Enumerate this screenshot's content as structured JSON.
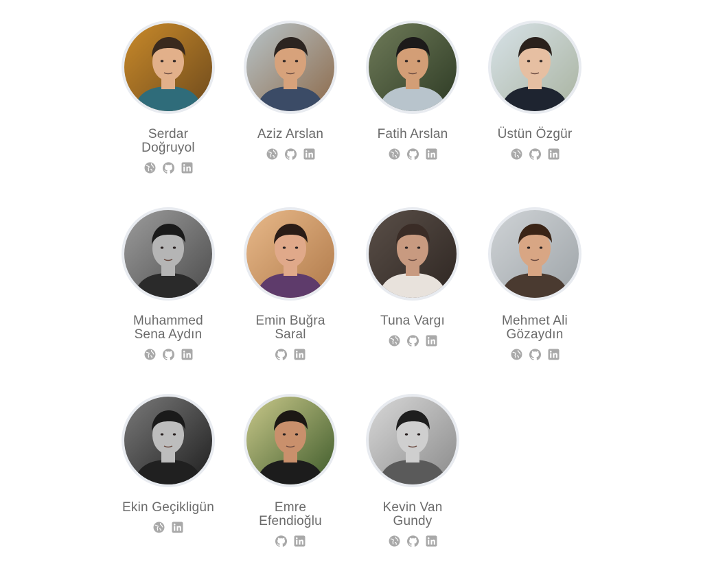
{
  "colors": {
    "icon": "#a9a9a9",
    "avatar_ring": "#e8ebf0",
    "name_text": "#6b6b6b"
  },
  "members": [
    {
      "first": "Serdar",
      "last": "Doğruyol",
      "links": [
        "globe-icon",
        "github-icon",
        "linkedin-icon"
      ],
      "bg": [
        "#c98a2a",
        "#6e4a1c"
      ],
      "skin": "#e2b08a",
      "hair": "#3a2a1e",
      "shirt": "#2f6c7a",
      "gray": false
    },
    {
      "first": "Aziz Arslan",
      "last": "",
      "links": [
        "globe-icon",
        "github-icon",
        "linkedin-icon"
      ],
      "bg": [
        "#b7c4c9",
        "#8d6a4a"
      ],
      "skin": "#d7a27b",
      "hair": "#2c2420",
      "shirt": "#3b4b66",
      "gray": false
    },
    {
      "first": "Fatih Arslan",
      "last": "",
      "links": [
        "globe-icon",
        "github-icon",
        "linkedin-icon"
      ],
      "bg": [
        "#6f7b59",
        "#2d3a24"
      ],
      "skin": "#d39e76",
      "hair": "#1c1a1a",
      "shirt": "#b8c4cc",
      "gray": false
    },
    {
      "first": "Üstün Özgür",
      "last": "",
      "links": [
        "globe-icon",
        "github-icon",
        "linkedin-icon"
      ],
      "bg": [
        "#d7e2e8",
        "#a9b3a0"
      ],
      "skin": "#e6bfa2",
      "hair": "#2a211c",
      "shirt": "#1e2430",
      "gray": false
    },
    {
      "first": "Muhammed",
      "last": "Sena Aydın",
      "links": [
        "globe-icon",
        "github-icon",
        "linkedin-icon"
      ],
      "bg": [
        "#9c9c9c",
        "#4c4c4c"
      ],
      "skin": "#b5b5b5",
      "hair": "#1a1a1a",
      "shirt": "#2a2a2a",
      "gray": true
    },
    {
      "first": "Emin Buğra",
      "last": "Saral",
      "links": [
        "github-icon",
        "linkedin-icon"
      ],
      "bg": [
        "#e8b98a",
        "#b07a4a"
      ],
      "skin": "#e0a98a",
      "hair": "#2a1c16",
      "shirt": "#5e3b6b",
      "gray": false
    },
    {
      "first": "Tuna Vargı",
      "last": "",
      "links": [
        "globe-icon",
        "github-icon",
        "linkedin-icon"
      ],
      "bg": [
        "#5a4f48",
        "#2e2622"
      ],
      "skin": "#c89a80",
      "hair": "#3a2c26",
      "shirt": "#e8e2dc",
      "gray": false
    },
    {
      "first": "Mehmet Ali",
      "last": "Gözaydın",
      "links": [
        "globe-icon",
        "github-icon",
        "linkedin-icon"
      ],
      "bg": [
        "#cfd3d6",
        "#9ea4a8"
      ],
      "skin": "#d8a684",
      "hair": "#3a2416",
      "shirt": "#4a3a30",
      "gray": false
    },
    {
      "first": "Ekin Geçikligün",
      "last": "",
      "links": [
        "globe-icon",
        "linkedin-icon"
      ],
      "bg": [
        "#7a7a7a",
        "#1e1e1e"
      ],
      "skin": "#bdbdbd",
      "hair": "#1a1a1a",
      "shirt": "#202020",
      "gray": true
    },
    {
      "first": "Emre",
      "last": "Efendioğlu",
      "links": [
        "github-icon",
        "linkedin-icon"
      ],
      "bg": [
        "#c9c88a",
        "#3d5a2a"
      ],
      "skin": "#c9906c",
      "hair": "#1c1814",
      "shirt": "#1c1c1c",
      "gray": false
    },
    {
      "first": "Kevin Van",
      "last": "Gundy",
      "links": [
        "globe-icon",
        "github-icon",
        "linkedin-icon"
      ],
      "bg": [
        "#d8d8d8",
        "#8a8a8a"
      ],
      "skin": "#cfcfcf",
      "hair": "#1e1e1e",
      "shirt": "#5a5a5a",
      "gray": true
    }
  ]
}
